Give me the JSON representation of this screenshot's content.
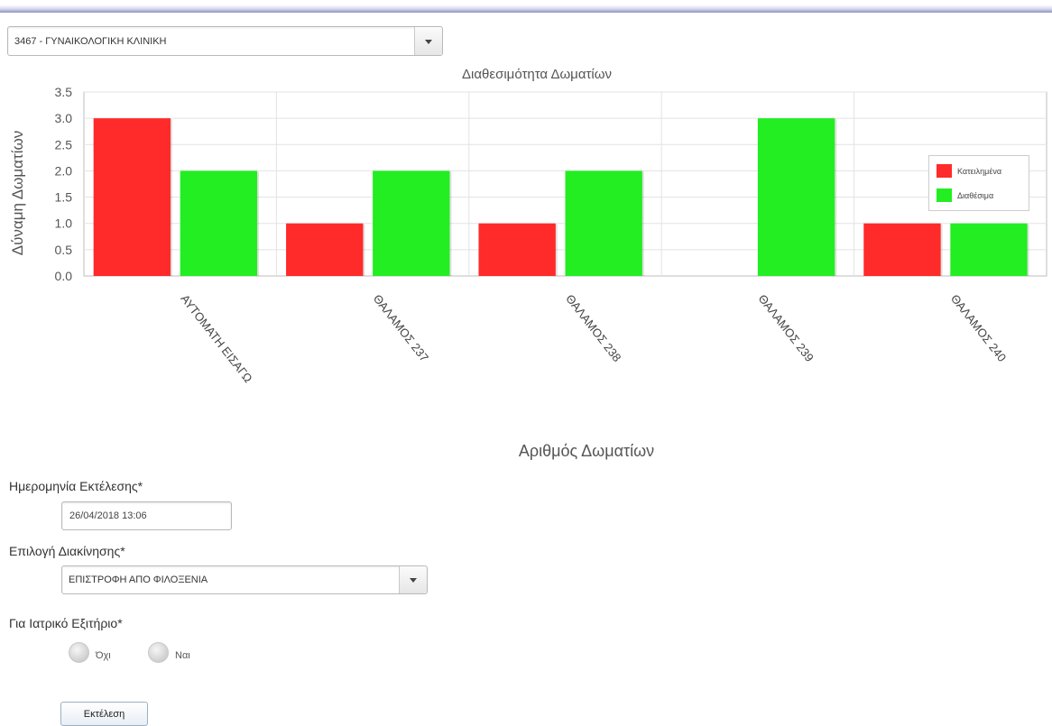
{
  "clinic_select": {
    "value": "3467 - ΓΥΝΑΙΚΟΛΟΓΙΚΗ ΚΛΙΝΙΚΗ"
  },
  "chart_data": {
    "type": "bar",
    "title": "Διαθεσιμότητα Δωματίων",
    "xlabel": "Αριθμός Δωματίων",
    "ylabel": "Δύναμη Δωματίων",
    "ylim": [
      0,
      3.5
    ],
    "yticks": [
      "0.0",
      "0.5",
      "1.0",
      "1.5",
      "2.0",
      "2.5",
      "3.0",
      "3.5"
    ],
    "grid": true,
    "legend_position": "right",
    "categories": [
      "ΑΥΤΟΜΑΤΗ ΕΙΣΑΓΩ",
      "ΘΑΛΑΜΟΣ 237",
      "ΘΑΛΑΜΟΣ 238",
      "ΘΑΛΑΜΟΣ 239",
      "ΘΑΛΑΜΟΣ 240"
    ],
    "series": [
      {
        "name": "Κατειλημένα",
        "color": "#ff2a2a",
        "values": [
          3,
          1,
          1,
          0,
          1
        ]
      },
      {
        "name": "Διαθέσιμα",
        "color": "#22ee22",
        "values": [
          2,
          2,
          2,
          3,
          1
        ]
      }
    ]
  },
  "form": {
    "date_label": "Ημερομηνία Εκτέλεσης*",
    "date_value": "26/04/2018 13:06",
    "movement_label": "Επιλογή Διακίνησης*",
    "movement_value": "ΕΠΙΣΤΡΟΦΗ ΑΠΟ ΦΙΛΟΞΕΝΙΑ",
    "discharge_label": "Για Ιατρικό Εξιτήριο*",
    "option_no": "Όχι",
    "option_yes": "Ναι",
    "submit_label": "Εκτέλεση"
  }
}
